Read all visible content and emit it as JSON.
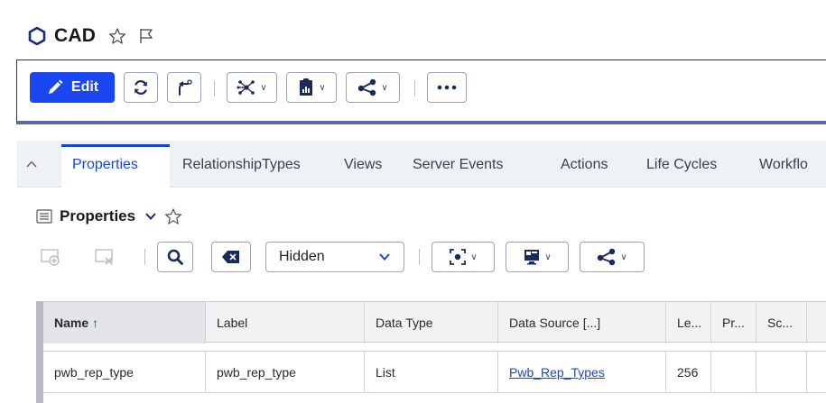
{
  "app": {
    "title": "CAD"
  },
  "toolbar": {
    "edit_label": "Edit",
    "icons": [
      "pencil-icon",
      "refresh-icon",
      "share-arrow-icon",
      "network-icon",
      "clipboard-chart-icon",
      "share-nodes-icon",
      "more-icon"
    ]
  },
  "tabs": [
    {
      "label": "Properties",
      "active": true
    },
    {
      "label": "RelationshipTypes"
    },
    {
      "label": "Views"
    },
    {
      "label": "Server Events"
    },
    {
      "label": "Actions"
    },
    {
      "label": "Life Cycles"
    },
    {
      "label": "Workflo"
    }
  ],
  "properties_panel": {
    "title": "Properties",
    "filter_select": {
      "value": "Hidden"
    }
  },
  "grid": {
    "columns": [
      {
        "label": "Name",
        "sorted": "asc"
      },
      {
        "label": "Label"
      },
      {
        "label": "Data Type"
      },
      {
        "label": "Data Source [...]"
      },
      {
        "label": "Le..."
      },
      {
        "label": "Pr..."
      },
      {
        "label": "Sc..."
      }
    ],
    "rows": [
      {
        "name": "pwb_rep_type",
        "label": "pwb_rep_type",
        "data_type": "List",
        "data_source": "Pwb_Rep_Types",
        "length": "256",
        "pr": "",
        "sc": ""
      }
    ]
  },
  "colors": {
    "accent": "#1a47f0",
    "tab_active": "#1a47c8",
    "toolbar_underline": "#5a6ca8"
  }
}
